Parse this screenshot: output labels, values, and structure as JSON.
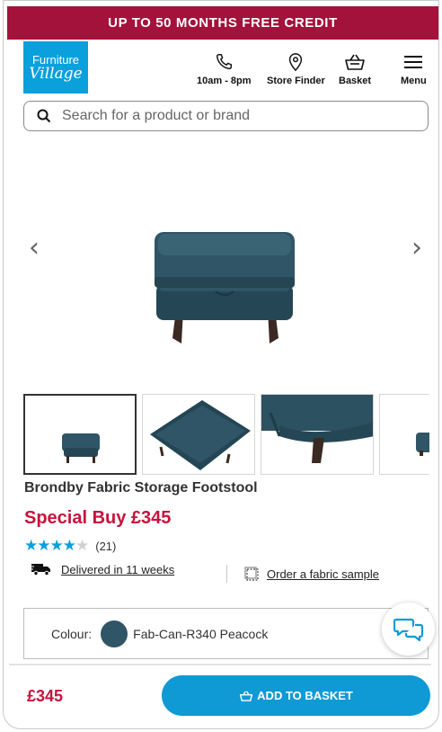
{
  "promo": {
    "text": "UP TO 50 MONTHS FREE CREDIT"
  },
  "logo": {
    "line1": "Furniture",
    "line2": "Village"
  },
  "header": {
    "nav": [
      {
        "label": "10am - 8pm",
        "icon": "phone-icon"
      },
      {
        "label": "Store Finder",
        "icon": "location-pin-icon"
      },
      {
        "label": "Basket",
        "icon": "basket-icon"
      },
      {
        "label": "Menu",
        "icon": "hamburger-menu-icon"
      }
    ]
  },
  "search": {
    "placeholder": "Search for a product or brand",
    "icon": "search-icon"
  },
  "gallery": {
    "prev_glyph": "‹",
    "next_glyph": "›",
    "product_color": "#2f5566"
  },
  "product": {
    "title": "Brondby Fabric Storage Footstool",
    "price_line": "Special Buy £345",
    "rating": {
      "value": 4,
      "max": 5,
      "count_text": "(21)"
    },
    "delivery_text": "Delivered in 11 weeks",
    "sample_text": "Order a fabric sample"
  },
  "colour": {
    "label": "Colour:",
    "value": "Fab-Can-R340 Peacock",
    "swatch": "#2f5566"
  },
  "footer_bar": {
    "price": "£345",
    "button_label": "ADD TO BASKET"
  },
  "colors": {
    "brand_red": "#a3123a",
    "price_red": "#c8123c",
    "brand_blue": "#0aa0dc",
    "button_blue": "#0f9ad6"
  }
}
